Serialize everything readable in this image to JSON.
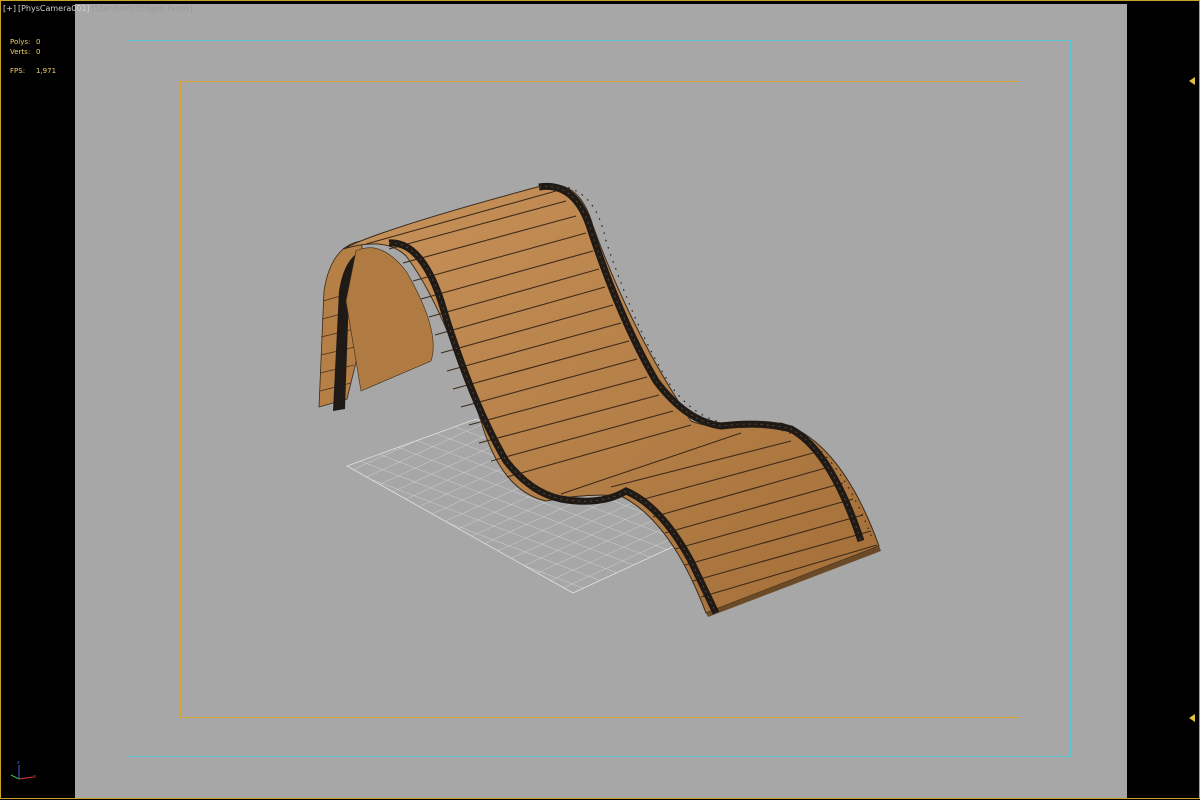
{
  "viewport": {
    "label_plus": "[+]",
    "label_camera": "[PhysCamera001]",
    "label_shading": "[Standard]",
    "label_edges": "[Edged Faces]"
  },
  "stats": {
    "polys_label": "Polys:",
    "polys_value": "0",
    "verts_label": "Verts:",
    "verts_value": "0",
    "fps_label": "FPS:",
    "fps_value": "1,971"
  },
  "icons": {
    "frame_arrow": "triangle-left-icon",
    "axis": "axis-tripod-icon"
  },
  "colors": {
    "viewport_bg": "#a7a7a7",
    "safe_frame_outer": "#5fc4d4",
    "safe_frame_inner": "#d9a334",
    "stats_text": "#f0d060",
    "wood_light": "#c28a4e",
    "wood_dark": "#a9743c",
    "strap": "#1f1a15"
  }
}
